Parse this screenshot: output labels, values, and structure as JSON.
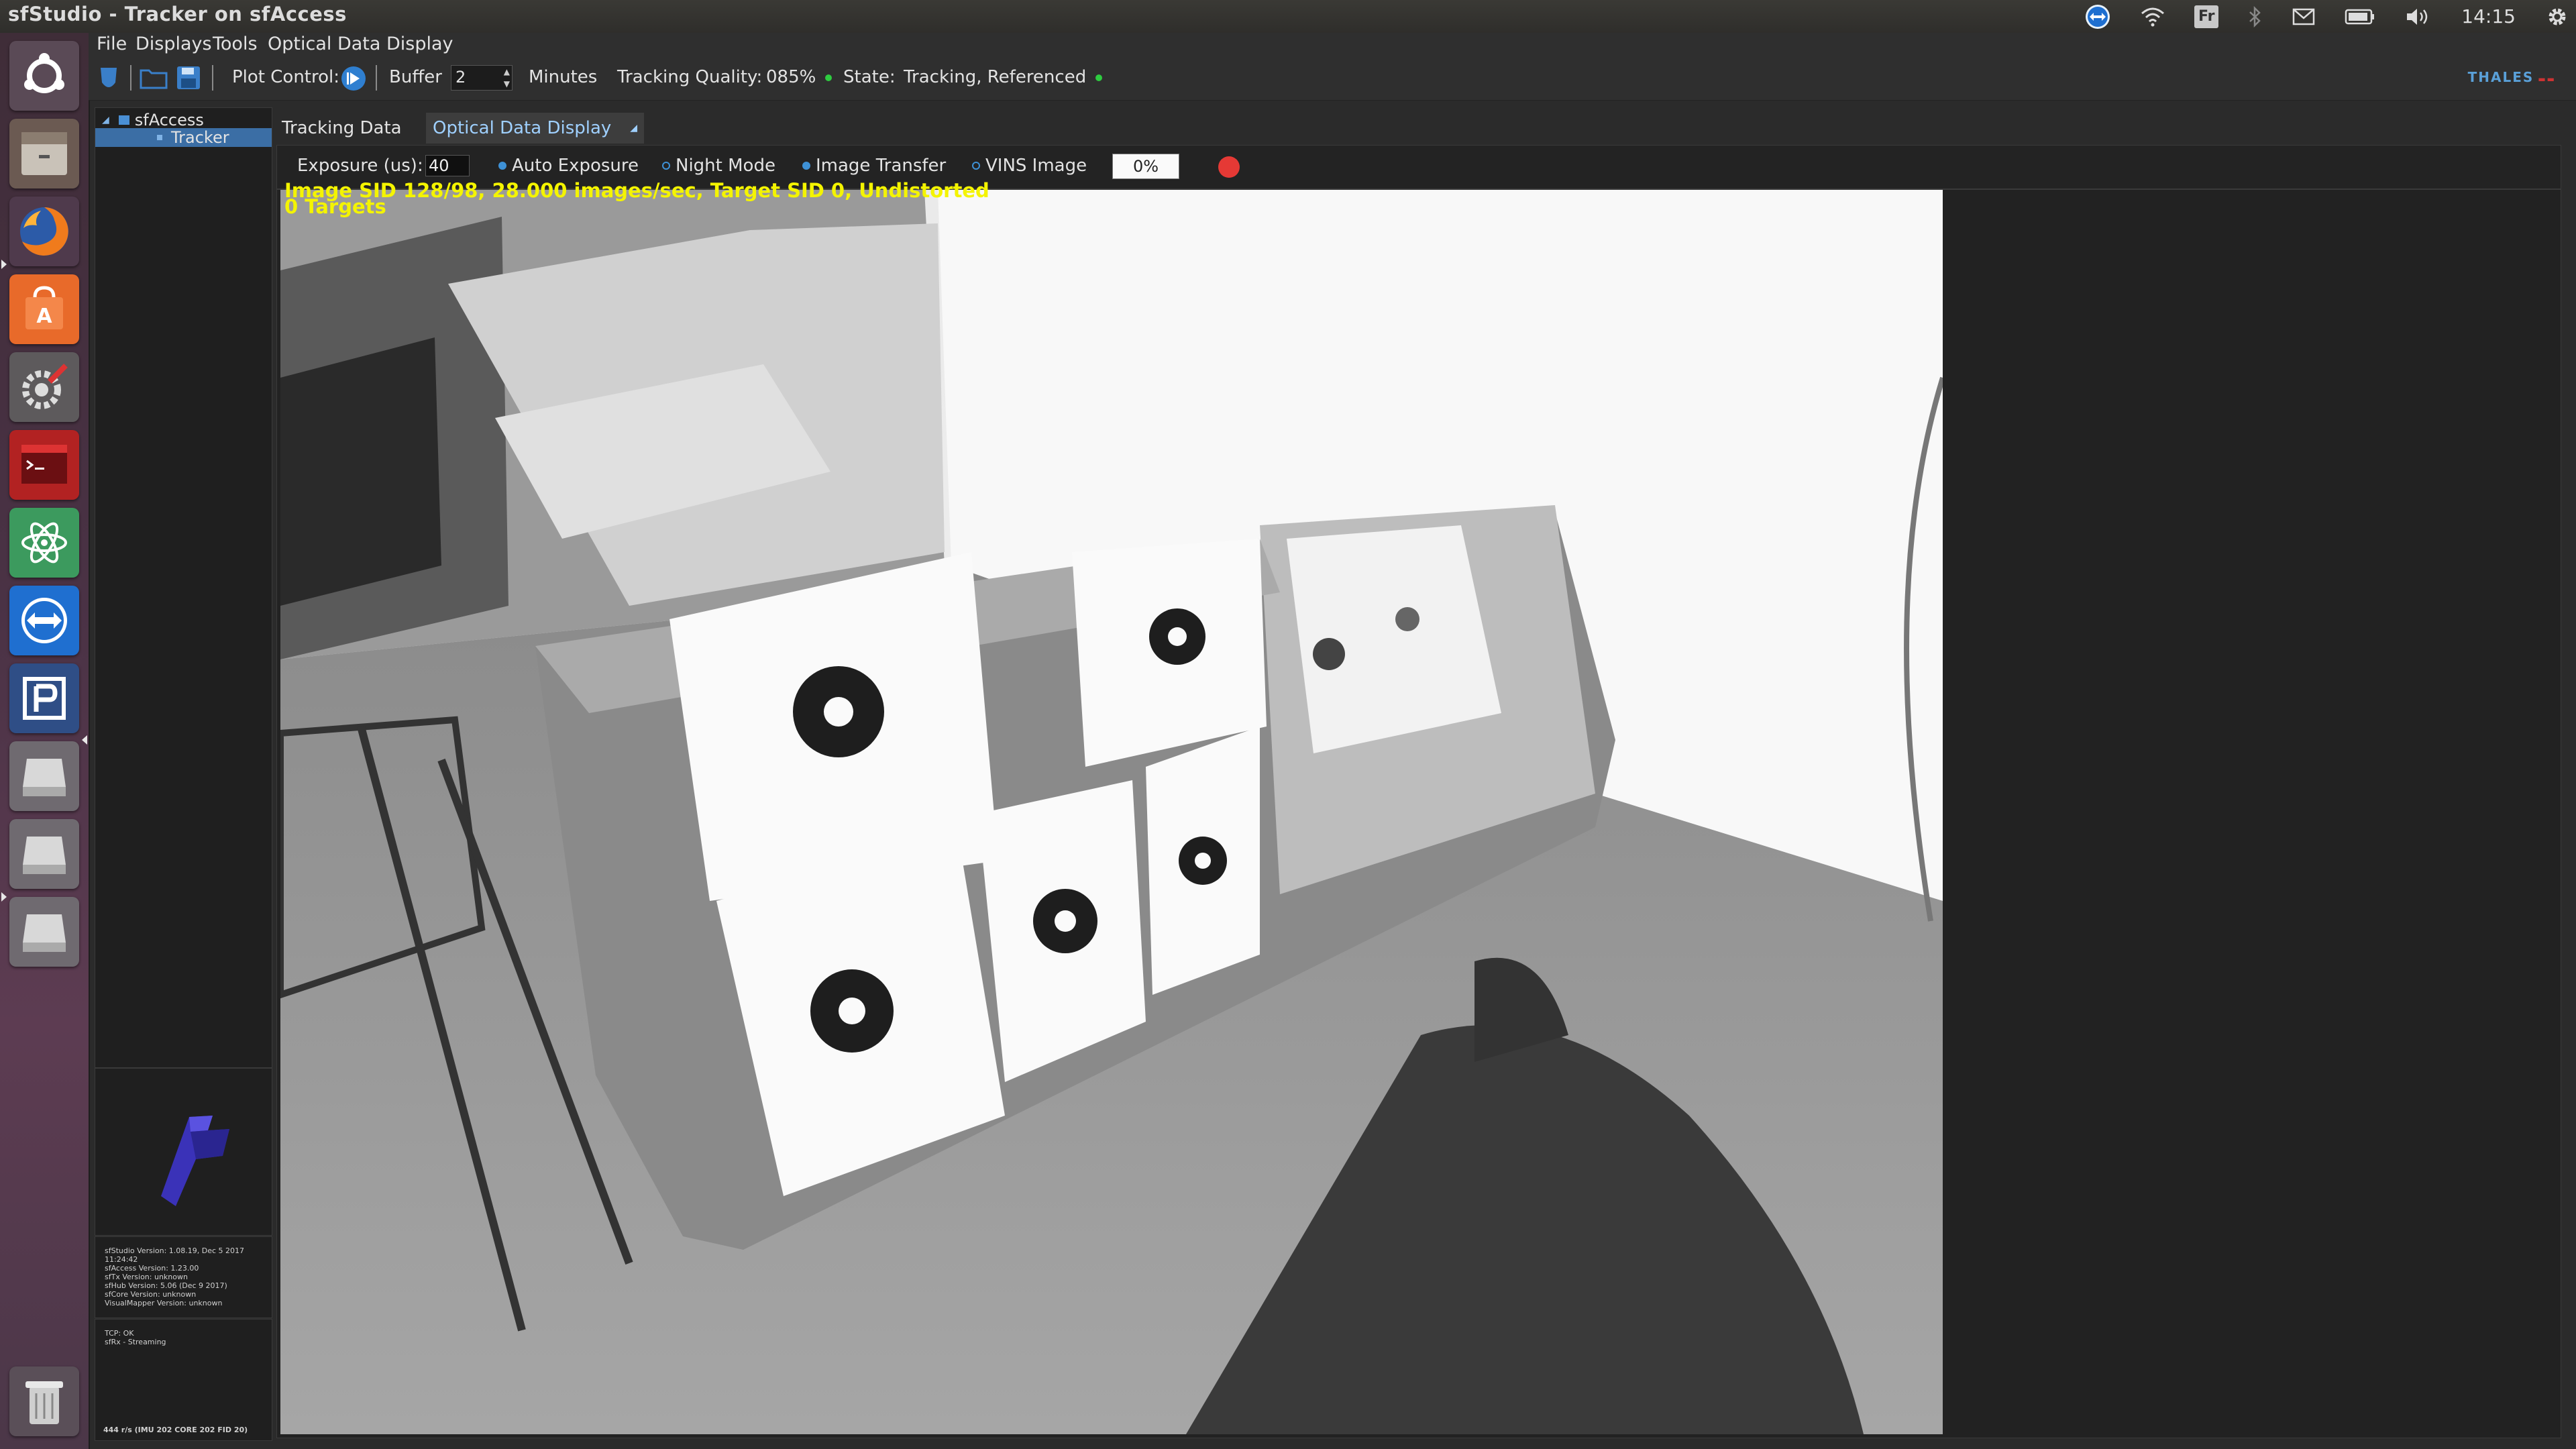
{
  "window": {
    "title": "sfStudio - Tracker on sfAccess"
  },
  "system_tray": {
    "keyboard_layout": "Fr",
    "clock": "14:15"
  },
  "launcher": {
    "items": [
      "ubuntu-home",
      "files",
      "firefox",
      "software-center",
      "system-settings",
      "terminal",
      "atom",
      "teamviewer",
      "custom-app",
      "drive-1",
      "drive-2",
      "drive-3",
      "trash"
    ]
  },
  "menu": {
    "items": [
      "File",
      "Displays",
      "Tools",
      "Optical Data Display"
    ]
  },
  "toolbar": {
    "plot_control_label": "Plot Control:",
    "buffer_label": "Buffer",
    "buffer_value": "2",
    "minutes_label": "Minutes",
    "tracking_quality_label": "Tracking Quality:",
    "tracking_quality_value": "085%",
    "state_label": "State:",
    "state_value": "Tracking, Referenced",
    "status_color": "#2ecc40",
    "brand": "THALES"
  },
  "tree": {
    "root": "sfAccess",
    "child": "Tracker"
  },
  "tabs": [
    "Tracking Data",
    "Optical Data Display"
  ],
  "controls": {
    "exposure_label": "Exposure (us):",
    "exposure_value": "40",
    "auto_exposure": "Auto Exposure",
    "night_mode": "Night Mode",
    "image_transfer": "Image Transfer",
    "vins_image": "VINS Image",
    "progress_text": "0%",
    "record_color": "#e53935"
  },
  "overlay": {
    "line1": "Image SID 128/98, 28.000 images/sec, Target SID 0, Undistorted",
    "line2": "0 Targets"
  },
  "versions": [
    "sfStudio Version: 1.08.19, Dec 5 2017",
    "11:24:42",
    "sfAccess Version: 1.23.00",
    "sfTx Version: unknown",
    "sfHub Version: 5.06 (Dec 9 2017)",
    "sfCore Version: unknown",
    "VisualMapper Version: unknown"
  ],
  "connection": {
    "tcp": "TCP: OK",
    "sfrx": "sfRx - Streaming",
    "rate": "444 r/s (IMU 202  CORE 202  FID 20)"
  }
}
